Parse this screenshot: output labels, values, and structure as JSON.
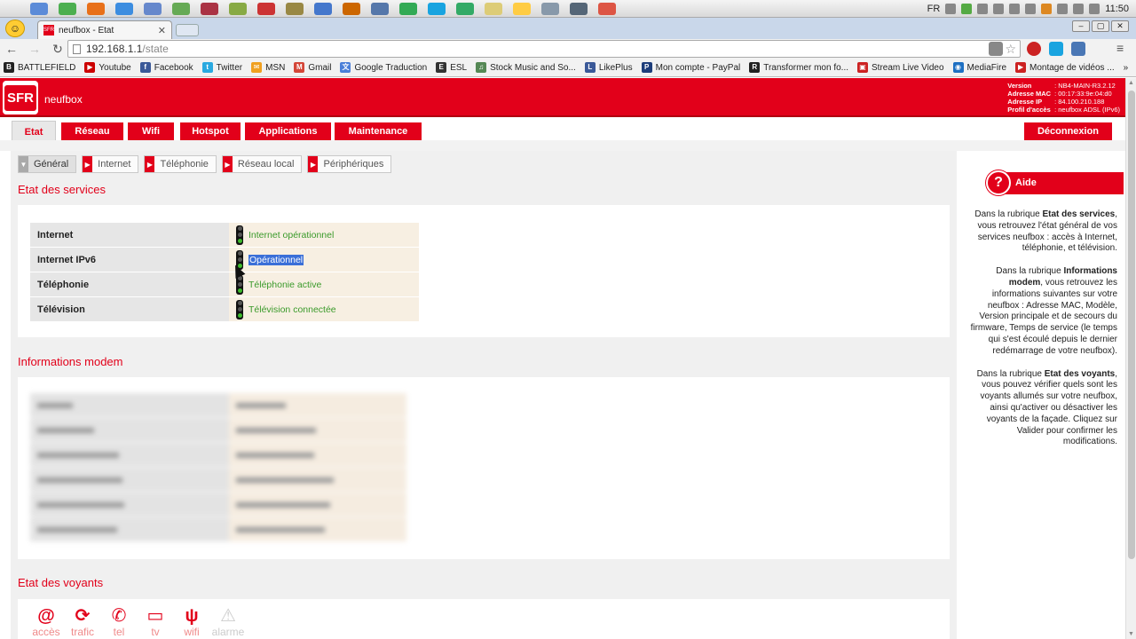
{
  "os": {
    "language": "FR",
    "clock": "11:50"
  },
  "browser": {
    "tab_title": "neufbox - Etat",
    "tab_favicon": "SFR",
    "url_host": "192.168.1.1",
    "url_path": "/state",
    "bookmarks": [
      {
        "label": "BATTLEFIELD",
        "icon": "battlefield-icon",
        "color": "#222222",
        "glyph": "B"
      },
      {
        "label": "Youtube",
        "icon": "youtube-icon",
        "color": "#cc0000",
        "glyph": "▶"
      },
      {
        "label": "Facebook",
        "icon": "facebook-icon",
        "color": "#3b5998",
        "glyph": "f"
      },
      {
        "label": "Twitter",
        "icon": "twitter-icon",
        "color": "#2aa9e0",
        "glyph": "t"
      },
      {
        "label": "MSN",
        "icon": "msn-icon",
        "color": "#f0a020",
        "glyph": "✉"
      },
      {
        "label": "Gmail",
        "icon": "gmail-icon",
        "color": "#d44638",
        "glyph": "M"
      },
      {
        "label": "Google Traduction",
        "icon": "translate-icon",
        "color": "#4a7fd8",
        "glyph": "文"
      },
      {
        "label": "ESL",
        "icon": "esl-icon",
        "color": "#333333",
        "glyph": "E"
      },
      {
        "label": "Stock Music and So...",
        "icon": "stock-music-icon",
        "color": "#558855",
        "glyph": "♫"
      },
      {
        "label": "LikePlus",
        "icon": "likeplus-icon",
        "color": "#3b5998",
        "glyph": "L"
      },
      {
        "label": "Mon compte - PayPal",
        "icon": "paypal-icon",
        "color": "#1d3d7a",
        "glyph": "P"
      },
      {
        "label": "Transformer mon fo...",
        "icon": "transform-icon",
        "color": "#222222",
        "glyph": "R"
      },
      {
        "label": "Stream Live Video",
        "icon": "stream-icon",
        "color": "#cc2222",
        "glyph": "▣"
      },
      {
        "label": "MediaFire",
        "icon": "mediafire-icon",
        "color": "#1d6fc2",
        "glyph": "◉"
      },
      {
        "label": "Montage de vidéos ...",
        "icon": "montage-icon",
        "color": "#cc2222",
        "glyph": "▶"
      }
    ],
    "bookmarks_more": "»"
  },
  "header": {
    "logo": "SFR",
    "brand": "neufbox",
    "device_info": [
      {
        "key": "Version",
        "value": ": NB4-MAIN-R3.2.12"
      },
      {
        "key": "Adresse MAC",
        "value": ": 00:17:33:9e:04:d0"
      },
      {
        "key": "Adresse IP",
        "value": ": 84.100.210.188"
      },
      {
        "key": "Profil d'accès",
        "value": ": neufbox ADSL (IPv6)"
      }
    ]
  },
  "nav": {
    "items": [
      "Etat",
      "Réseau",
      "Wifi",
      "Hotspot",
      "Applications",
      "Maintenance"
    ],
    "logout": "Déconnexion"
  },
  "subtabs": [
    "Général",
    "Internet",
    "Téléphonie",
    "Réseau local",
    "Périphériques"
  ],
  "services": {
    "title": "Etat des services",
    "rows": [
      {
        "label": "Internet",
        "status": "Internet opérationnel"
      },
      {
        "label": "Internet IPv6",
        "status": "Opérationnel"
      },
      {
        "label": "Téléphonie",
        "status": "Téléphonie active"
      },
      {
        "label": "Télévision",
        "status": "Télévision connectée"
      }
    ]
  },
  "modem": {
    "title": "Informations modem"
  },
  "voyants": {
    "title": "Etat des voyants",
    "items": [
      {
        "label": "accès",
        "icon": "at-icon",
        "glyph": "@"
      },
      {
        "label": "trafic",
        "icon": "sync-icon",
        "glyph": "⟳"
      },
      {
        "label": "tel",
        "icon": "phone-icon",
        "glyph": "✆"
      },
      {
        "label": "tv",
        "icon": "tv-icon",
        "glyph": "▭"
      },
      {
        "label": "wifi",
        "icon": "wifi-icon",
        "glyph": "ψ"
      },
      {
        "label": "alarme",
        "icon": "alarm-icon",
        "glyph": "⚠"
      }
    ]
  },
  "help": {
    "title": "Aide",
    "p1_pre": "Dans la rubrique ",
    "p1_bold": "Etat des services",
    "p1_post": ", vous retrouvez l'état général de vos services neufbox : accès à Internet, téléphonie, et télévision.",
    "p2_pre": "Dans la rubrique ",
    "p2_bold": "Informations modem",
    "p2_post": ", vous retrouvez les informations suivantes sur votre neufbox : Adresse MAC, Modèle, Version principale et de secours du firmware, Temps de service (le temps qui s'est écoulé depuis le dernier redémarrage de votre neufbox).",
    "p3_pre": "Dans la rubrique ",
    "p3_bold": "Etat des voyants",
    "p3_post": ", vous pouvez vérifier quels sont les voyants allumés sur votre neufbox, ainsi qu'activer ou désactiver les voyants de la façade. Cliquez sur Valider pour confirmer les modifications."
  },
  "colors": {
    "brand_red": "#e2001a",
    "status_green": "#3a9a2a",
    "selection_blue": "#3a6fd8"
  }
}
